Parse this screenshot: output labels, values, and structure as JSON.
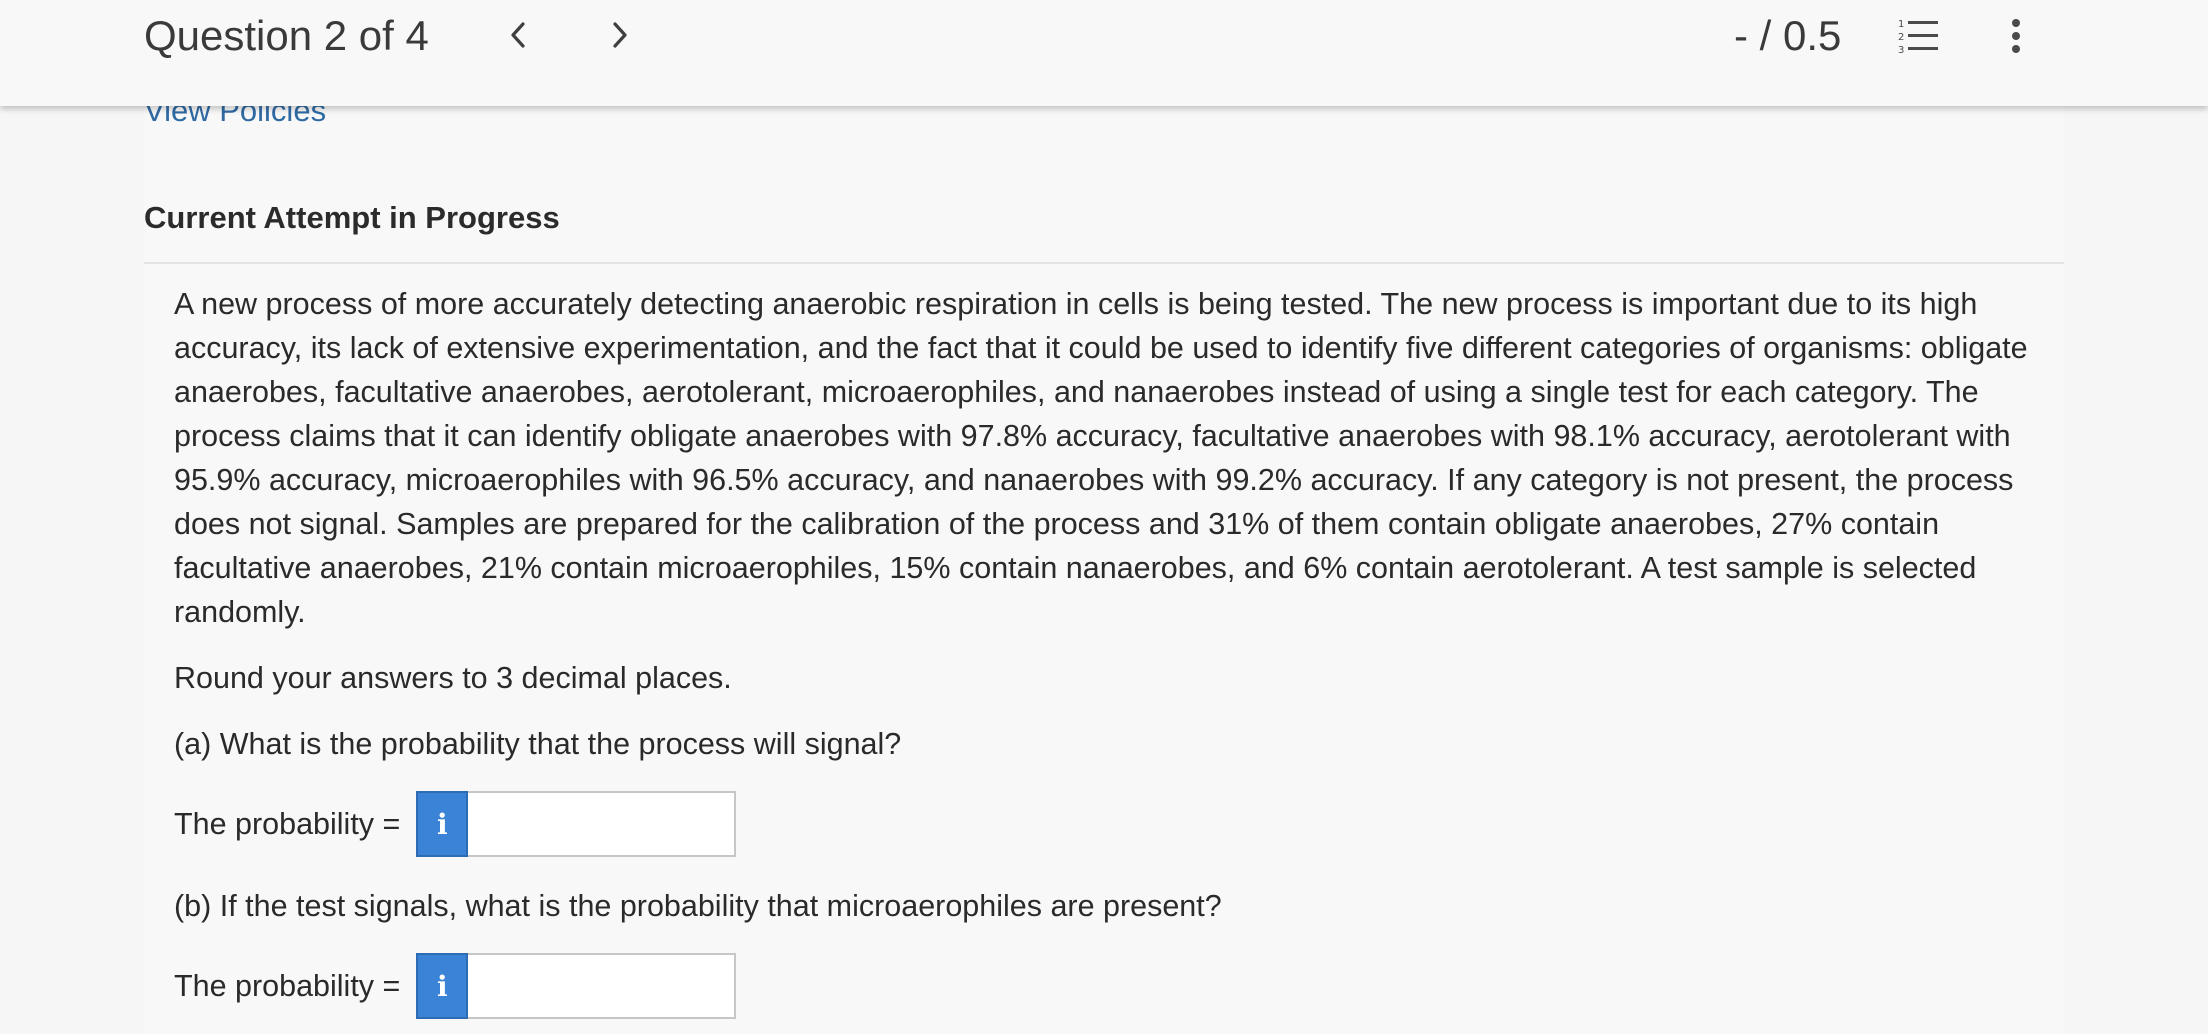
{
  "header": {
    "question_indicator": "Question 2 of 4",
    "score": "- / 0.5",
    "icons": {
      "previous": "chevron-left-icon",
      "next": "chevron-right-icon",
      "question_list": "numbered-list-icon",
      "more": "more-vertical-icon"
    }
  },
  "links": {
    "view_policies": "View Policies"
  },
  "attempt": {
    "heading": "Current Attempt in Progress"
  },
  "question": {
    "text": "A new process of more accurately detecting anaerobic respiration in cells is being tested. The new process is important due to its high accuracy, its lack of extensive experimentation, and the fact that it could be used to identify five different categories of organisms: obligate anaerobes, facultative anaerobes, aerotolerant, microaerophiles, and nanaerobes instead of using a single test for each category. The process claims that it can identify obligate anaerobes with 97.8% accuracy, facultative anaerobes with 98.1% accuracy, aerotolerant with 95.9% accuracy, microaerophiles with 96.5% accuracy, and nanaerobes with 99.2% accuracy. If any category is not present, the process does not signal. Samples are prepared for the calibration of the process and 31% of them contain obligate anaerobes, 27% contain facultative anaerobes, 21% contain microaerophiles, 15% contain nanaerobes, and 6% contain aerotolerant. A test sample is selected randomly.",
    "instruction": "Round your answers to 3 decimal places.",
    "parts": [
      {
        "prompt": "(a) What is the probability that the process will signal?",
        "answer_label": "The probability =",
        "info_glyph": "i",
        "answer_value": ""
      },
      {
        "prompt": "(b) If the test signals, what is the probability that microaerophiles are present?",
        "answer_label": "The probability =",
        "info_glyph": "i",
        "answer_value": ""
      }
    ]
  },
  "colors": {
    "link": "#2f6aa3",
    "info_button": "#3a83d6",
    "page_background": "#f6f6f6"
  }
}
